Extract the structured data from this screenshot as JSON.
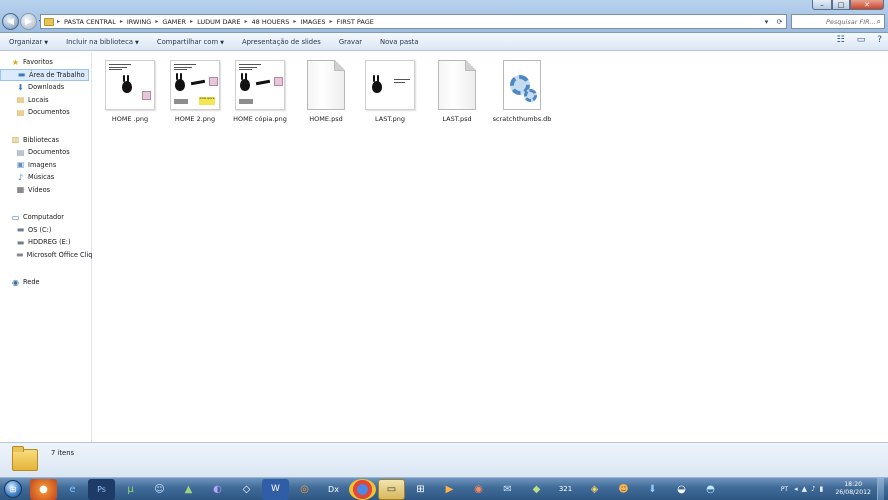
{
  "address": {
    "crumbs": [
      "PASTA CENTRAL",
      "IRWING",
      "GAMER",
      "LUDUM DARE",
      "48 HOUERS",
      "IMAGES",
      "FIRST PAGE"
    ],
    "search_placeholder": "Pesquisar FIR..."
  },
  "window_controls": {
    "minimize": "–",
    "maximize": "□",
    "close": "✕"
  },
  "toolbar": {
    "organize": "Organizar",
    "include": "Incluir na biblioteca",
    "share": "Compartilhar com",
    "slideshow": "Apresentação de slides",
    "burn": "Gravar",
    "new_folder": "Nova pasta"
  },
  "sidebar": {
    "favorites": {
      "label": "Favoritos",
      "items": [
        "Área de Trabalho",
        "Downloads",
        "Locais",
        "Documentos"
      ]
    },
    "libraries": {
      "label": "Bibliotecas",
      "items": [
        "Documentos",
        "Imagens",
        "Músicas",
        "Vídeos"
      ]
    },
    "computer": {
      "label": "Computador",
      "items": [
        "OS (C:)",
        "HDDREG (E:)",
        "Microsoft Office Cliq"
      ]
    },
    "network": {
      "label": "Rede"
    }
  },
  "files": [
    {
      "name": "HOME .png",
      "type": "png"
    },
    {
      "name": "HOME 2.png",
      "type": "png"
    },
    {
      "name": "HOME cópia.png",
      "type": "png"
    },
    {
      "name": "HOME.psd",
      "type": "psd"
    },
    {
      "name": "LAST.png",
      "type": "png"
    },
    {
      "name": "LAST.psd",
      "type": "psd"
    },
    {
      "name": "scratchthumbs.db",
      "type": "db"
    }
  ],
  "status": {
    "count": "7 itens"
  },
  "taskbar": {
    "lang": "PT",
    "time": "18:20",
    "date": "26/08/2012"
  }
}
